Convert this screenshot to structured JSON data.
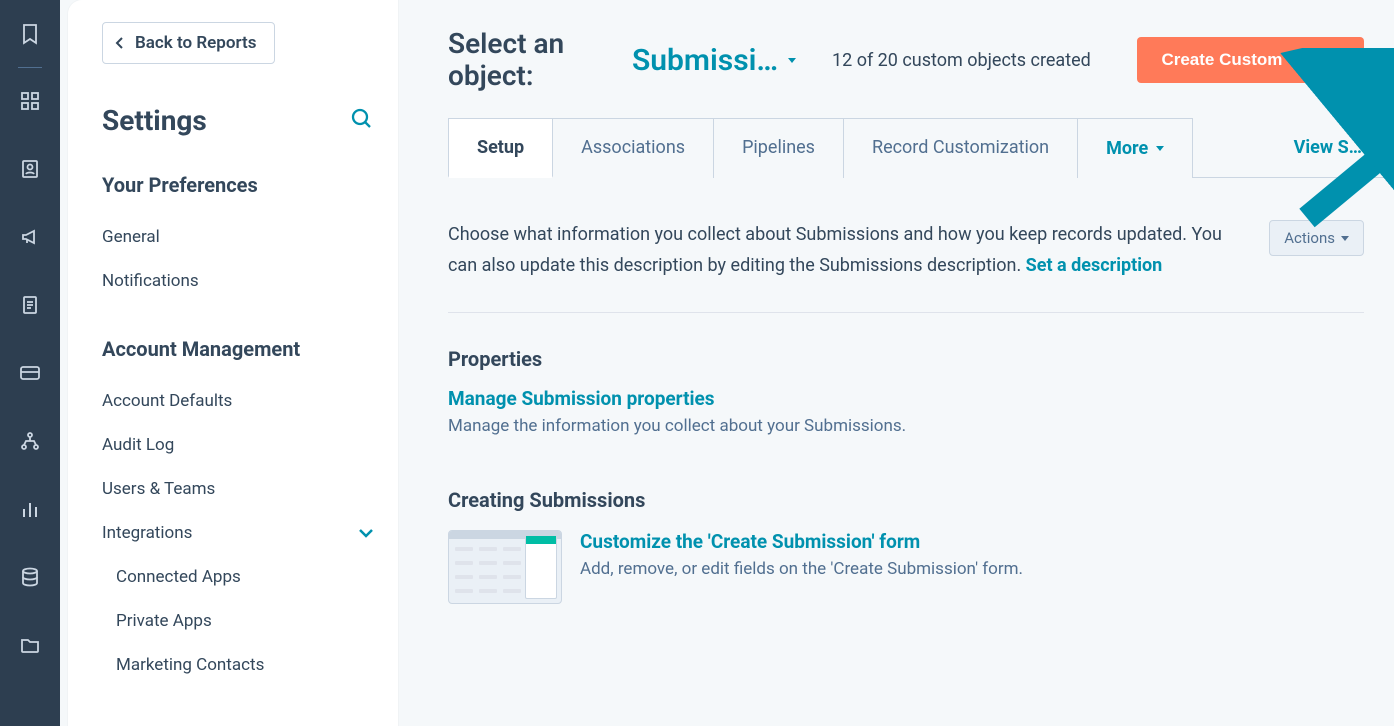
{
  "rail": {
    "icons": [
      "bookmark",
      "grid",
      "contact",
      "megaphone",
      "document",
      "card",
      "sitemap",
      "chart",
      "database",
      "folder"
    ]
  },
  "sidebar": {
    "back_label": "Back to Reports",
    "title": "Settings",
    "section1_label": "Your Preferences",
    "items1": [
      "General",
      "Notifications"
    ],
    "section2_label": "Account Management",
    "items2": [
      "Account Defaults",
      "Audit Log",
      "Users & Teams"
    ],
    "integrations_label": "Integrations",
    "integration_children": [
      "Connected Apps",
      "Private Apps",
      "Marketing Contacts"
    ]
  },
  "header": {
    "select_label": "Select an object:",
    "object_name": "Submissi…",
    "count_text": "12 of 20 custom objects created",
    "create_btn": "Create Custom Object"
  },
  "tabs": {
    "setup": "Setup",
    "associations": "Associations",
    "pipelines": "Pipelines",
    "record": "Record Customization",
    "more": "More",
    "view": "View S…"
  },
  "desc": {
    "text": "Choose what information you collect about Submissions and how you keep records updated. You can also update this description by editing the Submissions description. ",
    "link": "Set a description",
    "actions": "Actions"
  },
  "properties": {
    "heading": "Properties",
    "link": "Manage Submission properties",
    "sub": "Manage the information you collect about your Submissions."
  },
  "creating": {
    "heading": "Creating Submissions",
    "link": "Customize the 'Create Submission' form",
    "sub": "Add, remove, or edit fields on the 'Create Submission' form."
  }
}
